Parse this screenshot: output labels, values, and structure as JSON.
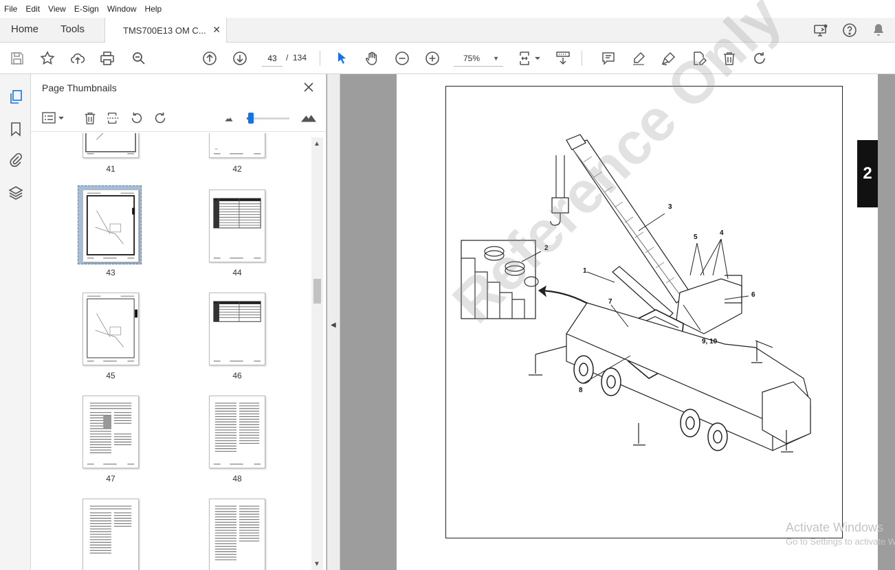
{
  "menubar": {
    "items": [
      "File",
      "Edit",
      "View",
      "E-Sign",
      "Window",
      "Help"
    ]
  },
  "tabs": {
    "home": "Home",
    "tools": "Tools",
    "document": "TMS700E13 OM C..."
  },
  "toolbar": {
    "current_page": "43",
    "page_separator": "/",
    "total_pages": "134",
    "zoom": "75%"
  },
  "panel": {
    "title": "Page Thumbnails",
    "slider_level_percent": 10
  },
  "thumbnails": [
    {
      "label": "41"
    },
    {
      "label": "42"
    },
    {
      "label": "43",
      "selected": true
    },
    {
      "label": "44"
    },
    {
      "label": "45"
    },
    {
      "label": "46"
    },
    {
      "label": "47"
    },
    {
      "label": "48"
    },
    {
      "label": ""
    },
    {
      "label": ""
    }
  ],
  "document": {
    "chapter_tab": "2",
    "callouts": [
      "1",
      "2",
      "3",
      "4",
      "5",
      "6",
      "7",
      "8",
      "9, 10"
    ],
    "watermark": "Reference Only"
  },
  "os_overlay": {
    "line1": "Activate Windows",
    "line2": "Go to Settings to activate Windows."
  },
  "colors": {
    "accent": "#1473e6",
    "selection": "#a6bfd8",
    "doc_background": "#9d9d9d"
  }
}
